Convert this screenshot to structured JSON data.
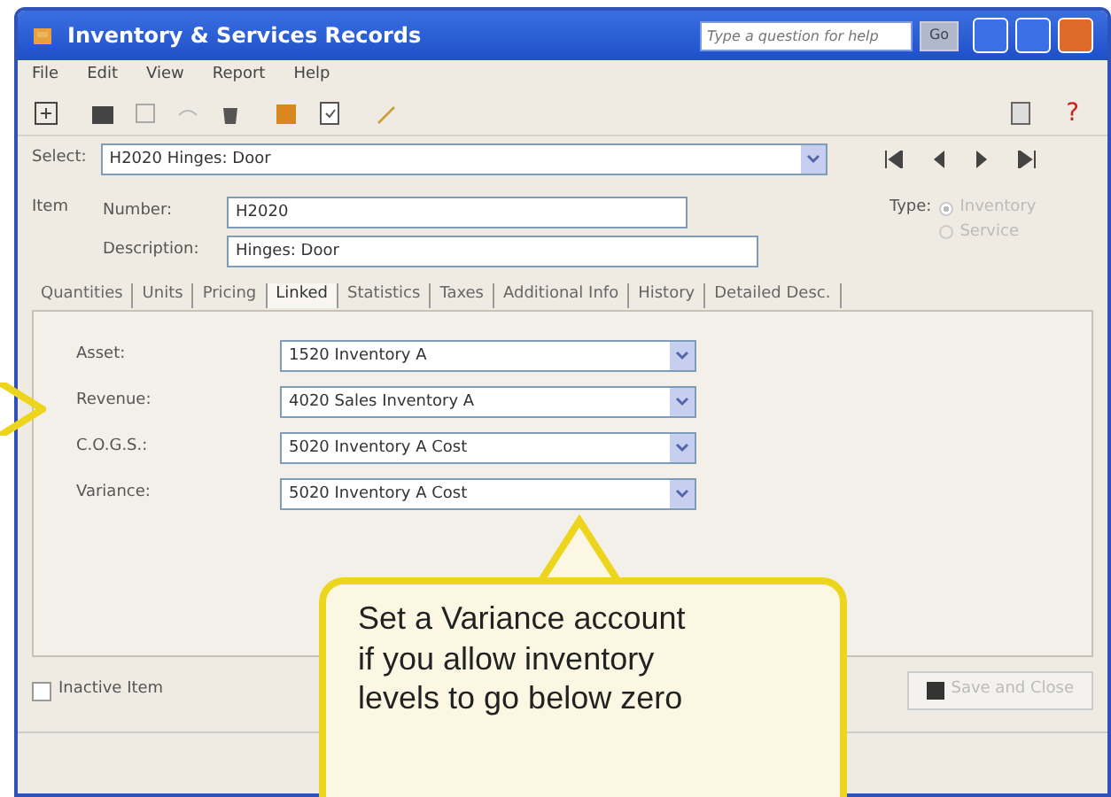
{
  "window": {
    "title": "Inventory & Services Records",
    "help_placeholder": "Type a question for help",
    "go_label": "Go"
  },
  "help_glyph": "?",
  "menu": [
    "File",
    "Edit",
    "View",
    "Report",
    "Help"
  ],
  "select": {
    "label": "Select:",
    "value": "H2020 Hinges: Door"
  },
  "item": {
    "label": "Item",
    "number_label": "Number:",
    "number": "H2020",
    "description_label": "Description:",
    "description": "Hinges: Door",
    "type_label": "Type:",
    "types": [
      {
        "label": "Inventory",
        "selected": true
      },
      {
        "label": "Service",
        "selected": false
      }
    ]
  },
  "tabs": [
    {
      "label": "Quantities",
      "selected": false
    },
    {
      "label": "Units",
      "selected": false
    },
    {
      "label": "Pricing",
      "selected": false
    },
    {
      "label": "Linked",
      "selected": true
    },
    {
      "label": "Statistics",
      "selected": false
    },
    {
      "label": "Taxes",
      "selected": false
    },
    {
      "label": "Additional Info",
      "selected": false
    },
    {
      "label": "History",
      "selected": false
    },
    {
      "label": "Detailed Desc.",
      "selected": false
    }
  ],
  "accounts": [
    {
      "label": "Asset:",
      "value": "1520 Inventory A"
    },
    {
      "label": "Revenue:",
      "value": "4020 Sales Inventory A"
    },
    {
      "label": "C.O.G.S.:",
      "value": "5020 Inventory A Cost"
    },
    {
      "label": "Variance:",
      "value": "5020 Inventory A Cost"
    }
  ],
  "inactive": {
    "label": "Inactive Item",
    "checked": false
  },
  "save_button": {
    "label": "Save and Close",
    "disabled": true
  },
  "callout": {
    "text": "Set a Variance account if you allow inventory levels to go below zero"
  }
}
